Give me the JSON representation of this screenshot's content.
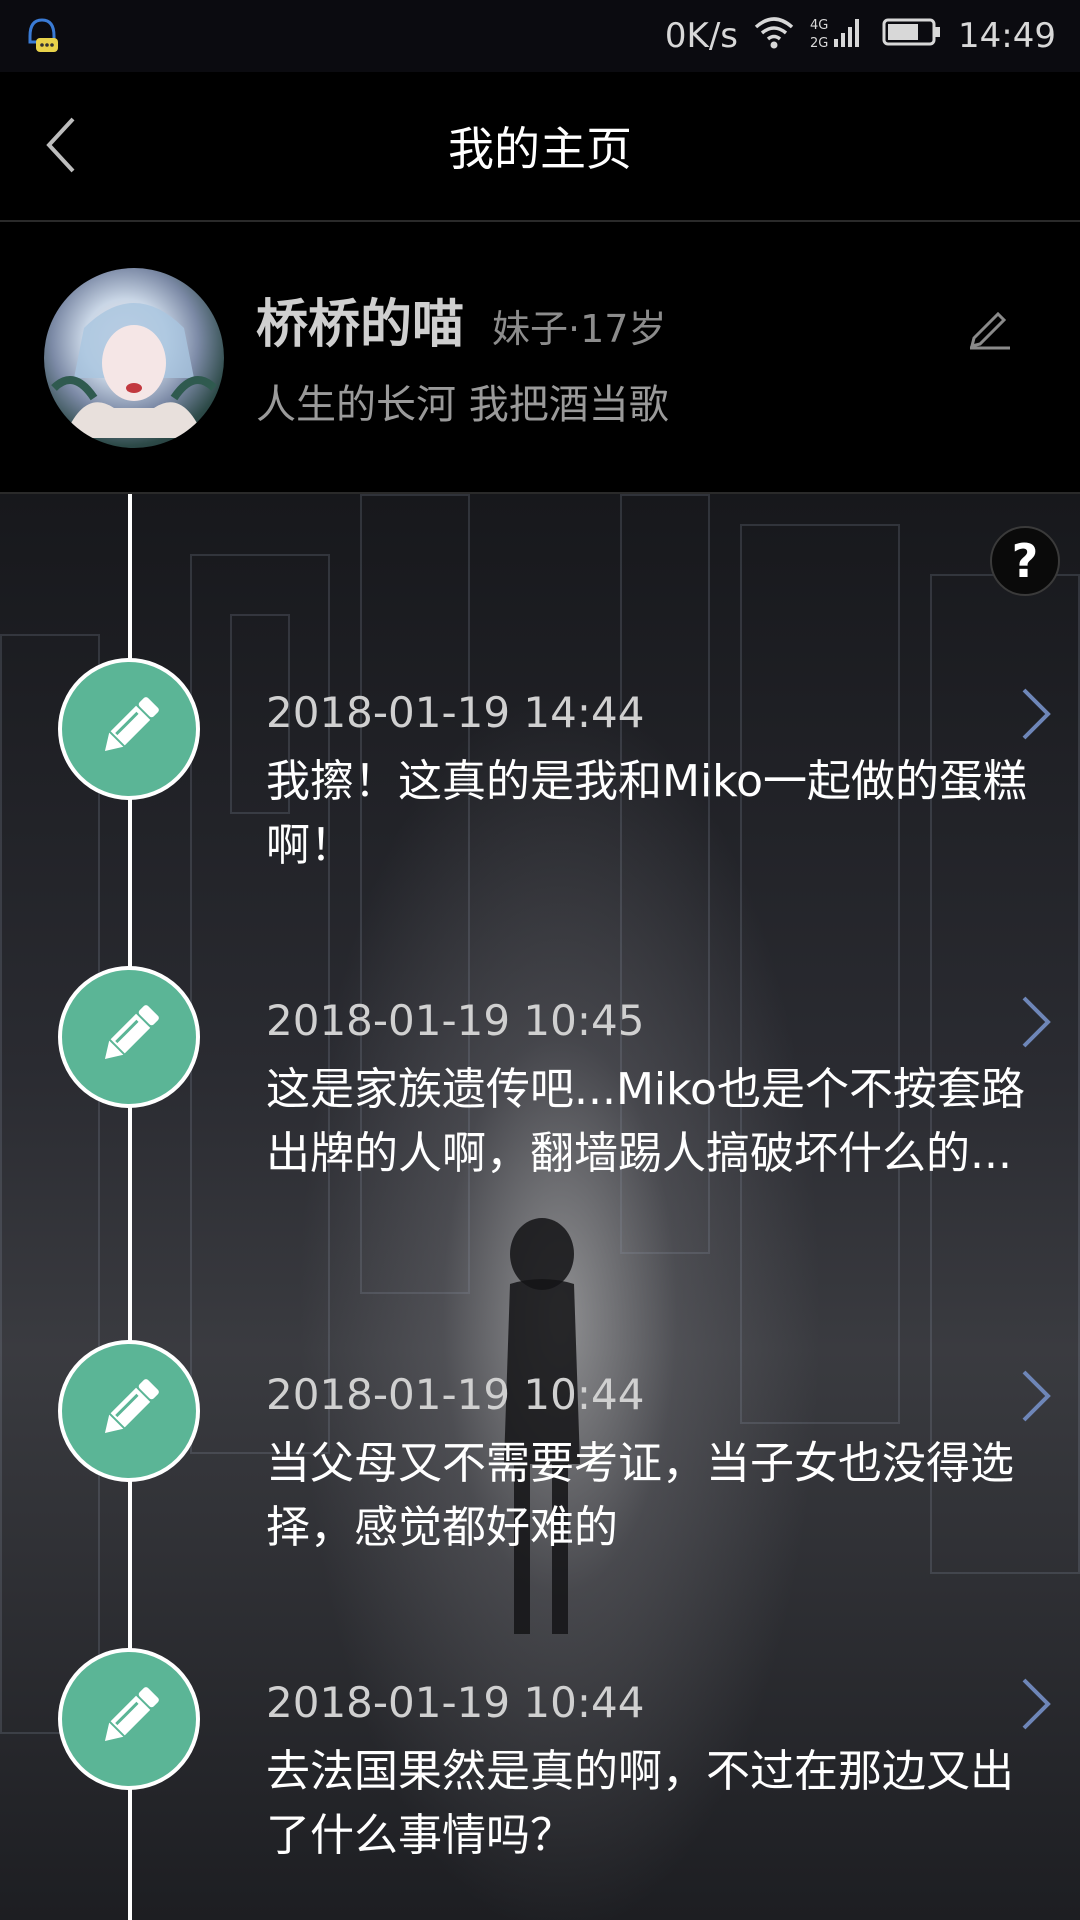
{
  "status_bar": {
    "speed": "0K/s",
    "network": "4G 2G",
    "time": "14:49",
    "icons": [
      "notification-icon",
      "wifi-icon",
      "signal-icon",
      "battery-icon"
    ]
  },
  "header": {
    "title": "我的主页",
    "back_icon": "chevron-left-icon"
  },
  "profile": {
    "name": "桥桥的喵",
    "meta": "妹子·17岁",
    "bio": "人生的长河 我把酒当歌",
    "edit_icon": "pencil-icon"
  },
  "help": {
    "label": "?"
  },
  "entries": [
    {
      "date": "2018-01-19 14:44",
      "text": "我擦！这真的是我和Miko一起做的蛋糕啊！"
    },
    {
      "date": "2018-01-19 10:45",
      "text": "这是家族遗传吧...Miko也是个不按套路出牌的人啊，翻墙踢人搞破坏什么的..."
    },
    {
      "date": "2018-01-19 10:44",
      "text": "当父母又不需要考证，当子女也没得选择，感觉都好难的"
    },
    {
      "date": "2018-01-19 10:44",
      "text": "去法国果然是真的啊，不过在那边又出了什么事情吗？"
    }
  ],
  "colors": {
    "accent_green": "#5bb596",
    "arrow_blue": "#6e86b8"
  }
}
